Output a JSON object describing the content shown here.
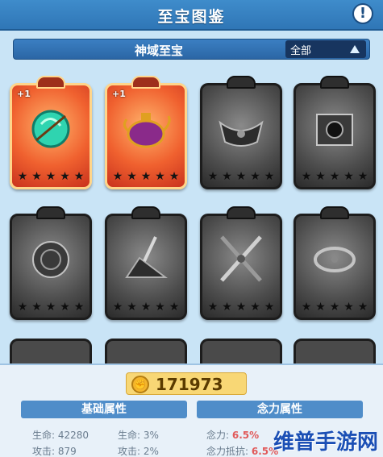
{
  "header": {
    "title": "至宝图鉴",
    "info_icon": "exclamation-icon"
  },
  "subheader": {
    "title": "神域至宝",
    "filter_label": "全部",
    "filter_icon": "triangle-up-icon"
  },
  "cards": [
    {
      "tier": "red",
      "badge": "+1",
      "icon": "green-orb-icon",
      "stars": 5
    },
    {
      "tier": "red",
      "badge": "+1",
      "icon": "magic-teapot-icon",
      "stars": 5
    },
    {
      "tier": "grey",
      "badge": "",
      "icon": "crown-relic-icon",
      "stars": 5
    },
    {
      "tier": "grey",
      "badge": "",
      "icon": "cube-relic-icon",
      "stars": 5
    },
    {
      "tier": "grey",
      "badge": "",
      "icon": "rune-disc-icon",
      "stars": 5
    },
    {
      "tier": "grey",
      "badge": "",
      "icon": "stone-shard-icon",
      "stars": 5
    },
    {
      "tier": "grey",
      "badge": "",
      "icon": "crossed-swords-icon",
      "stars": 5
    },
    {
      "tier": "grey",
      "badge": "",
      "icon": "ring-relic-icon",
      "stars": 5
    }
  ],
  "score": {
    "value": "171973",
    "icon": "fist-coin-icon"
  },
  "attributes": {
    "basic_label": "基础属性",
    "mind_label": "念力属性",
    "basic_rows": [
      {
        "label": "生命: 42280",
        "label2": "生命: 3%"
      },
      {
        "label": "攻击: 879",
        "label2": "攻击: 2%"
      }
    ],
    "mind_rows": [
      {
        "label": "念力: ",
        "value": "6.5%"
      },
      {
        "label": "念力抵抗: ",
        "value": "6.5%"
      }
    ]
  },
  "watermark": "维普手游网",
  "colors": {
    "header": "#2f76b6",
    "red_card": "#f0612f",
    "grey_card": "#4d4d4d",
    "accent_pink": "#e15a5a"
  }
}
